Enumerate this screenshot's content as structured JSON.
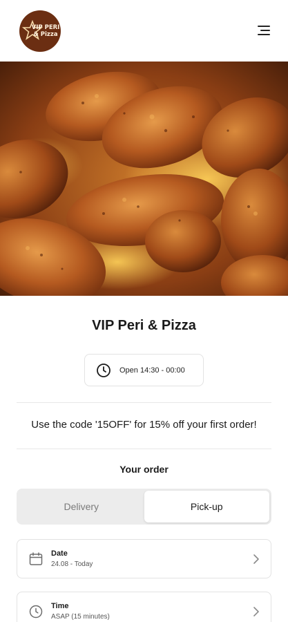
{
  "header": {
    "logo_text_line1": "VIP PERI",
    "logo_text_line2": "& Pizza",
    "logo_icon": "star-icon",
    "menu_icon": "hamburger-menu-icon"
  },
  "hero": {
    "image": "grilled-peri-chicken-wings-photo"
  },
  "restaurant": {
    "name": "VIP Peri & Pizza",
    "hours": "Open 14:30 - 00:00",
    "hours_icon": "clock-icon"
  },
  "promo": {
    "text": "Use the code '15OFF' for 15% off your first order!"
  },
  "order": {
    "title": "Your order",
    "modes": [
      {
        "label": "Delivery",
        "active": false
      },
      {
        "label": "Pick-up",
        "active": true
      }
    ],
    "date": {
      "label": "Date",
      "value": "24.08 - Today",
      "icon": "calendar-icon"
    },
    "time": {
      "label": "Time",
      "value": "ASAP (15 minutes)",
      "icon": "clock-icon"
    }
  },
  "colors": {
    "logo_bg": "#6b2e12",
    "toggle_bg": "#ececec",
    "border": "#e2e2e2"
  }
}
